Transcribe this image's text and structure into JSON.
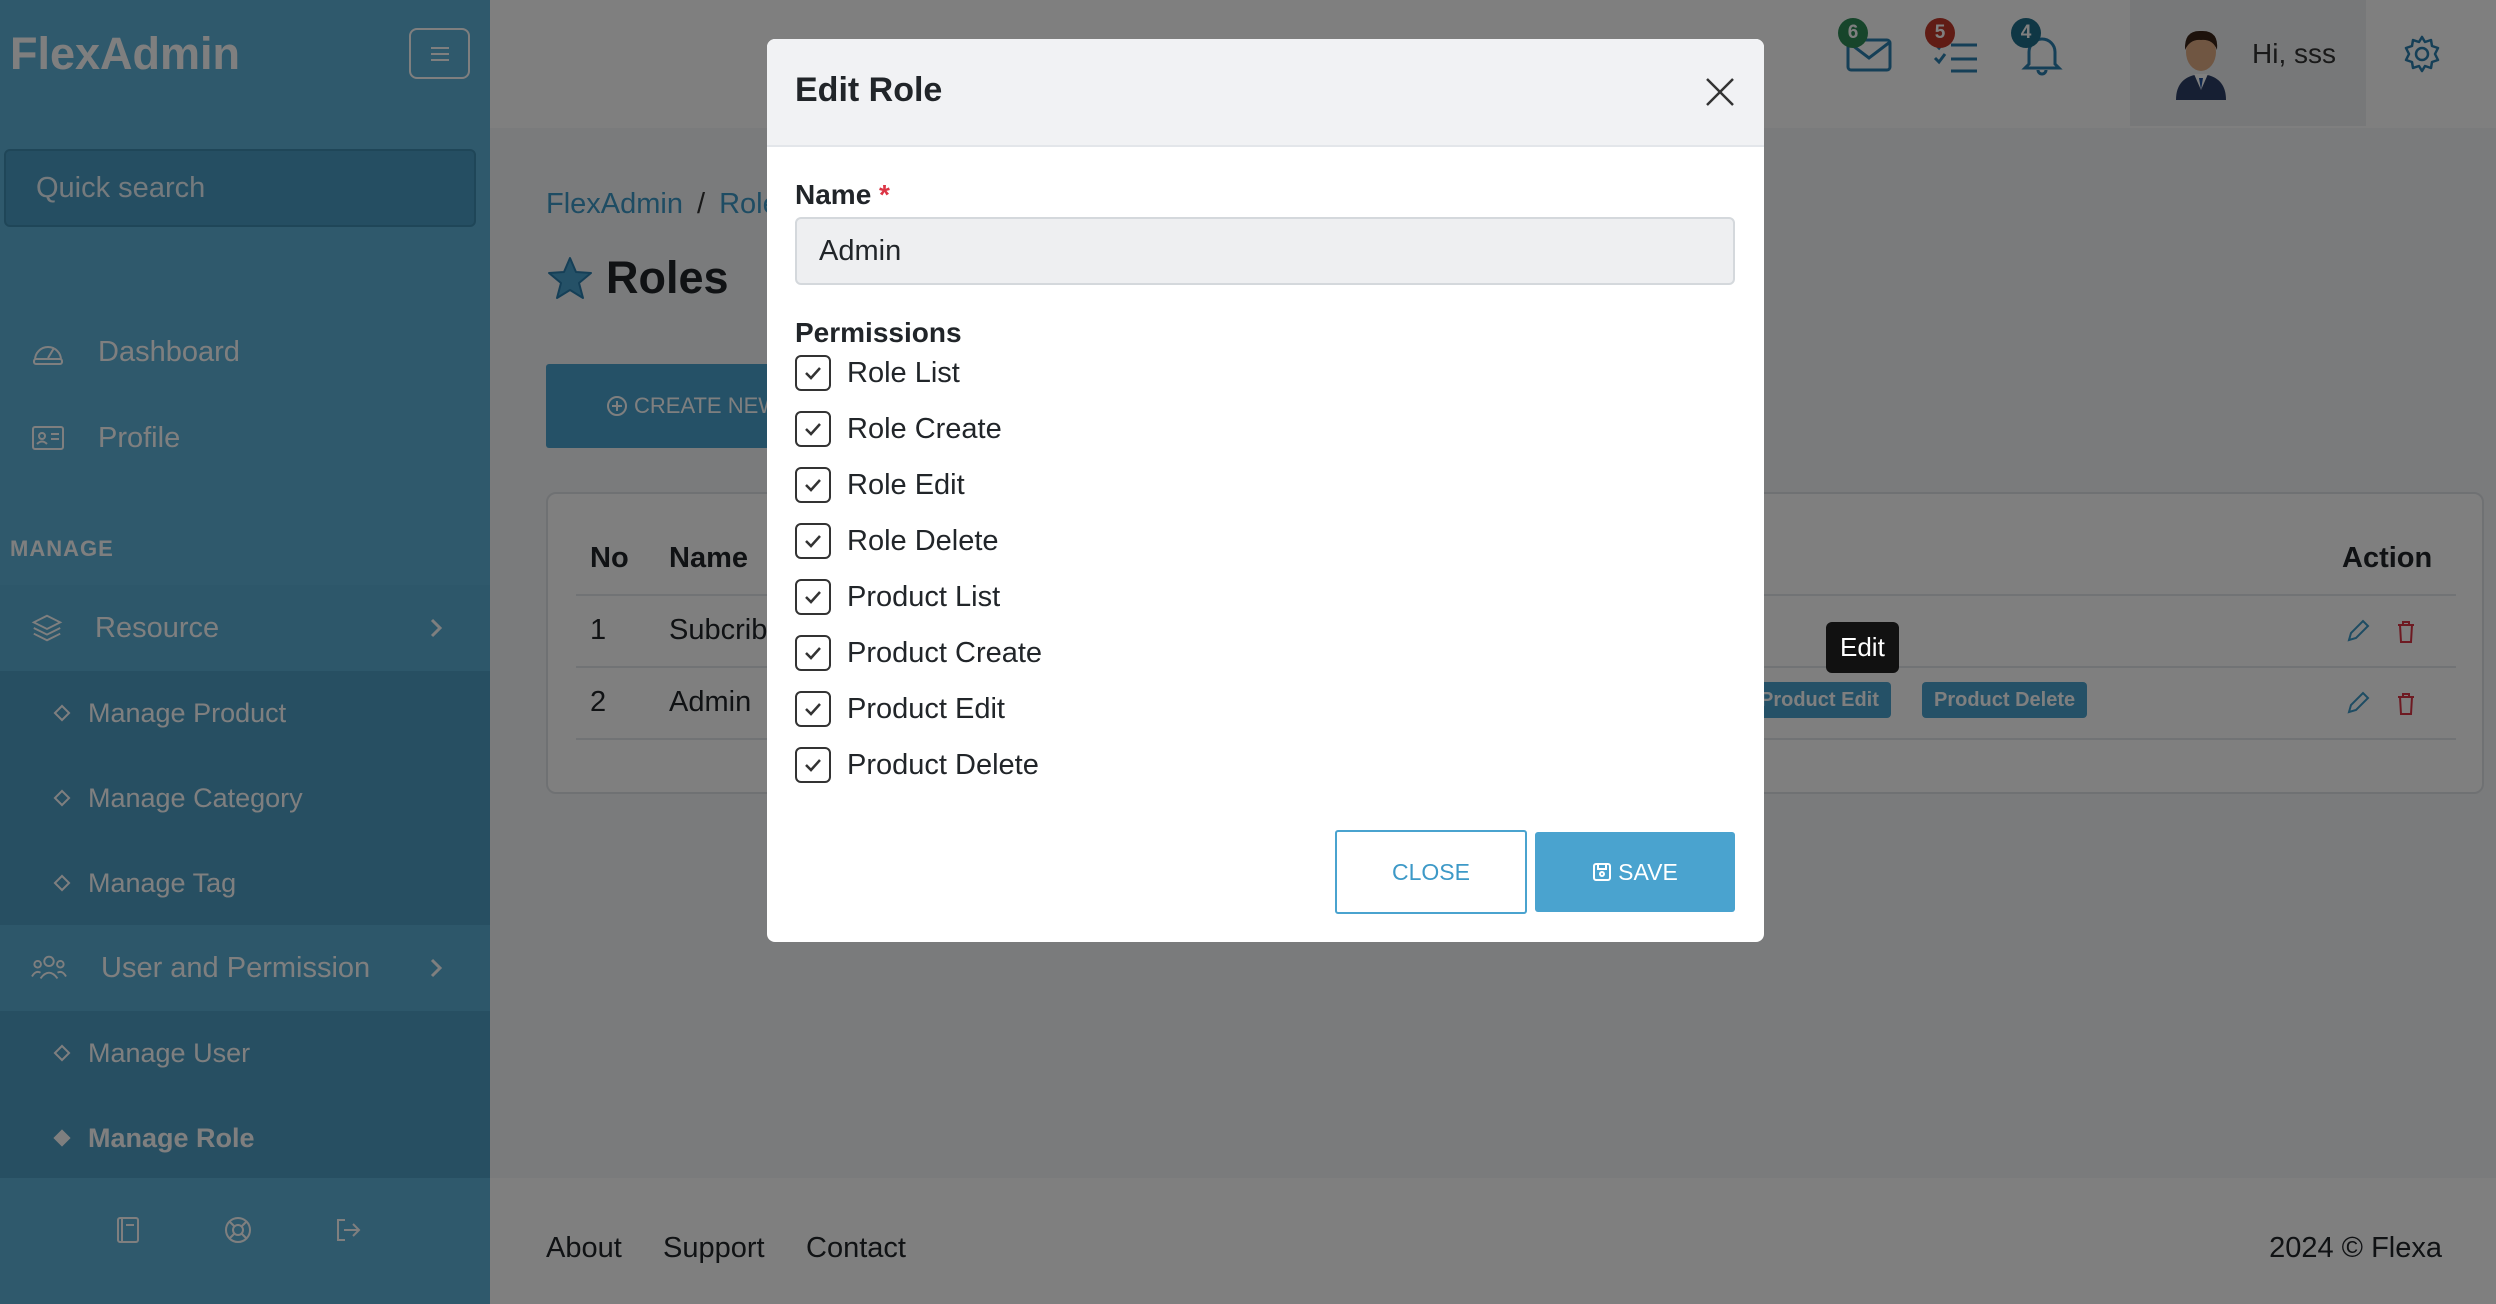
{
  "app": {
    "brand": "FlexAdmin"
  },
  "sidebar": {
    "search_placeholder": "Quick search",
    "items": [
      {
        "label": "Dashboard",
        "icon": "speedometer-icon"
      },
      {
        "label": "Profile",
        "icon": "id-card-icon"
      }
    ],
    "section_label": "MANAGE",
    "groups": [
      {
        "label": "Resource",
        "icon": "layers-icon",
        "children": [
          "Manage Product",
          "Manage Category",
          "Manage Tag"
        ]
      },
      {
        "label": "User and Permission",
        "icon": "users-icon",
        "children": [
          "Manage User",
          "Manage Role"
        ],
        "active_child": "Manage Role"
      }
    ],
    "footer_icons": [
      "book-icon",
      "lifebuoy-icon",
      "logout-icon"
    ]
  },
  "topbar": {
    "messages_count": "6",
    "tasks_count": "5",
    "notifications_count": "4",
    "greeting": "Hi, sss",
    "colors": {
      "messages_badge": "#2e8b57",
      "tasks_badge": "#c0392b",
      "notifications_badge": "#1f6f8b"
    }
  },
  "page": {
    "breadcrumb": [
      "FlexAdmin",
      "Roles"
    ],
    "title": "Roles",
    "create_button": "CREATE NEW"
  },
  "table": {
    "headers": {
      "no": "No",
      "name": "Name",
      "action": "Action"
    },
    "rows": [
      {
        "no": "1",
        "name": "Subcriber"
      },
      {
        "no": "2",
        "name": "Admin",
        "visible_badges": [
          "Product Edit",
          "Product Delete"
        ]
      }
    ],
    "tooltip": "Edit"
  },
  "footer": {
    "links": [
      "About",
      "Support",
      "Contact"
    ],
    "copyright": "2024 © Flexa"
  },
  "modal": {
    "title": "Edit Role",
    "name_label": "Name",
    "required_mark": "*",
    "name_value": "Admin",
    "permissions_label": "Permissions",
    "permissions": [
      {
        "label": "Role List",
        "checked": true
      },
      {
        "label": "Role Create",
        "checked": true
      },
      {
        "label": "Role Edit",
        "checked": true
      },
      {
        "label": "Role Delete",
        "checked": true
      },
      {
        "label": "Product List",
        "checked": true
      },
      {
        "label": "Product Create",
        "checked": true
      },
      {
        "label": "Product Edit",
        "checked": true
      },
      {
        "label": "Product Delete",
        "checked": true
      }
    ],
    "close_button": "CLOSE",
    "save_button": "SAVE"
  },
  "colors": {
    "sidebar": "#5fb3d9",
    "accent": "#4aa3cf",
    "danger": "#dc3545"
  }
}
